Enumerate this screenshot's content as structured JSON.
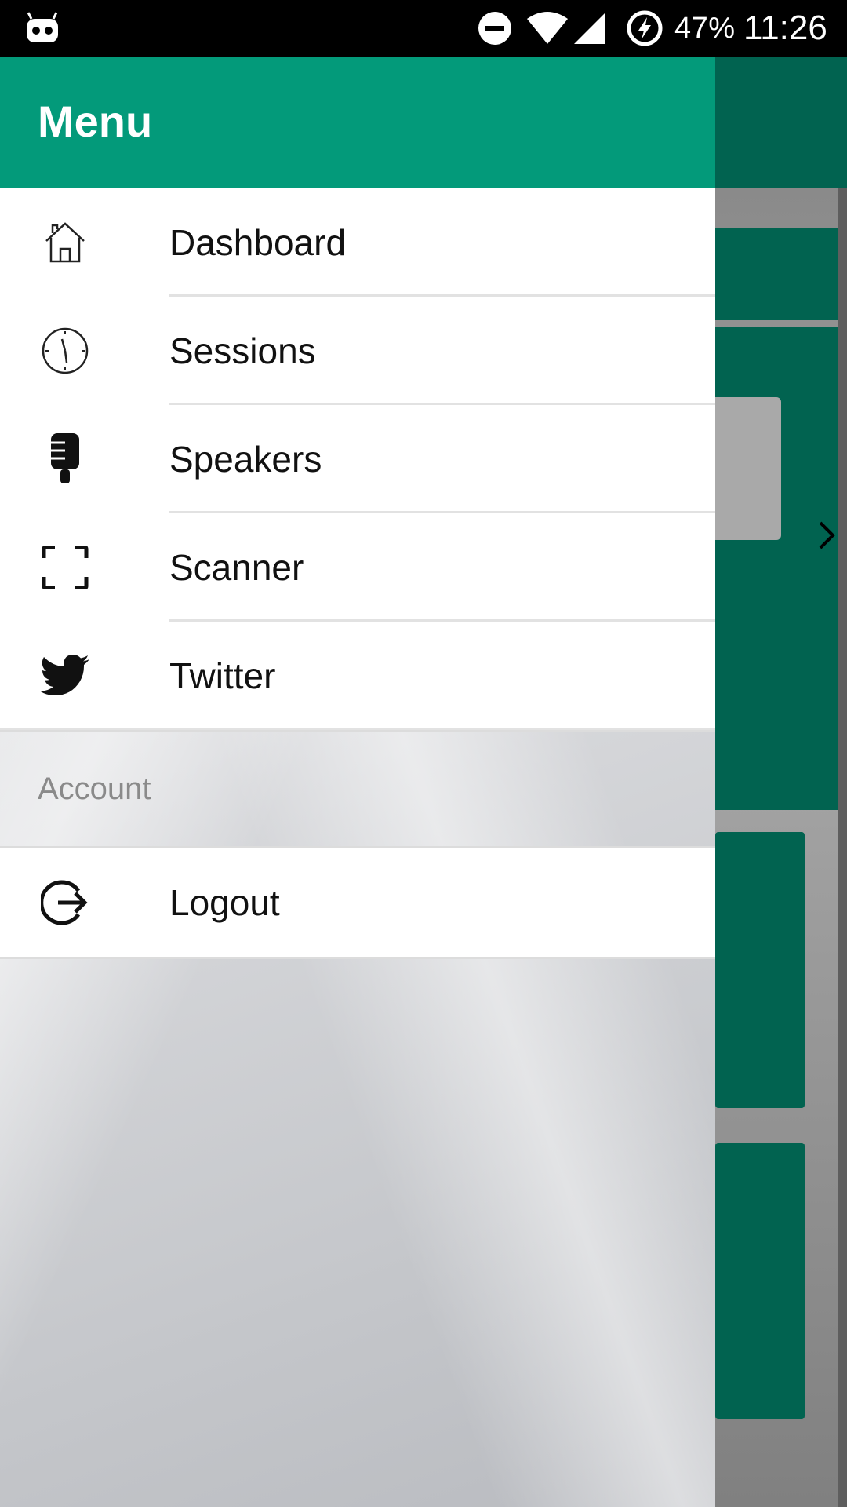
{
  "status_bar": {
    "battery_percent": "47%",
    "time": "11:26",
    "icons": [
      "robot-notification-icon",
      "do-not-disturb-icon",
      "wifi-icon",
      "cell-signal-icon",
      "battery-charging-icon"
    ]
  },
  "drawer": {
    "title": "Menu",
    "items": [
      {
        "label": "Dashboard",
        "icon": "home-icon"
      },
      {
        "label": "Sessions",
        "icon": "clock-icon"
      },
      {
        "label": "Speakers",
        "icon": "microphone-icon"
      },
      {
        "label": "Scanner",
        "icon": "scanner-frame-icon"
      },
      {
        "label": "Twitter",
        "icon": "twitter-bird-icon"
      }
    ],
    "section_label": "Account",
    "logout": {
      "label": "Logout",
      "icon": "logout-icon"
    }
  },
  "colors": {
    "drawer_header": "#039a7a",
    "app_bar": "#016350",
    "status_bar": "#000000"
  }
}
